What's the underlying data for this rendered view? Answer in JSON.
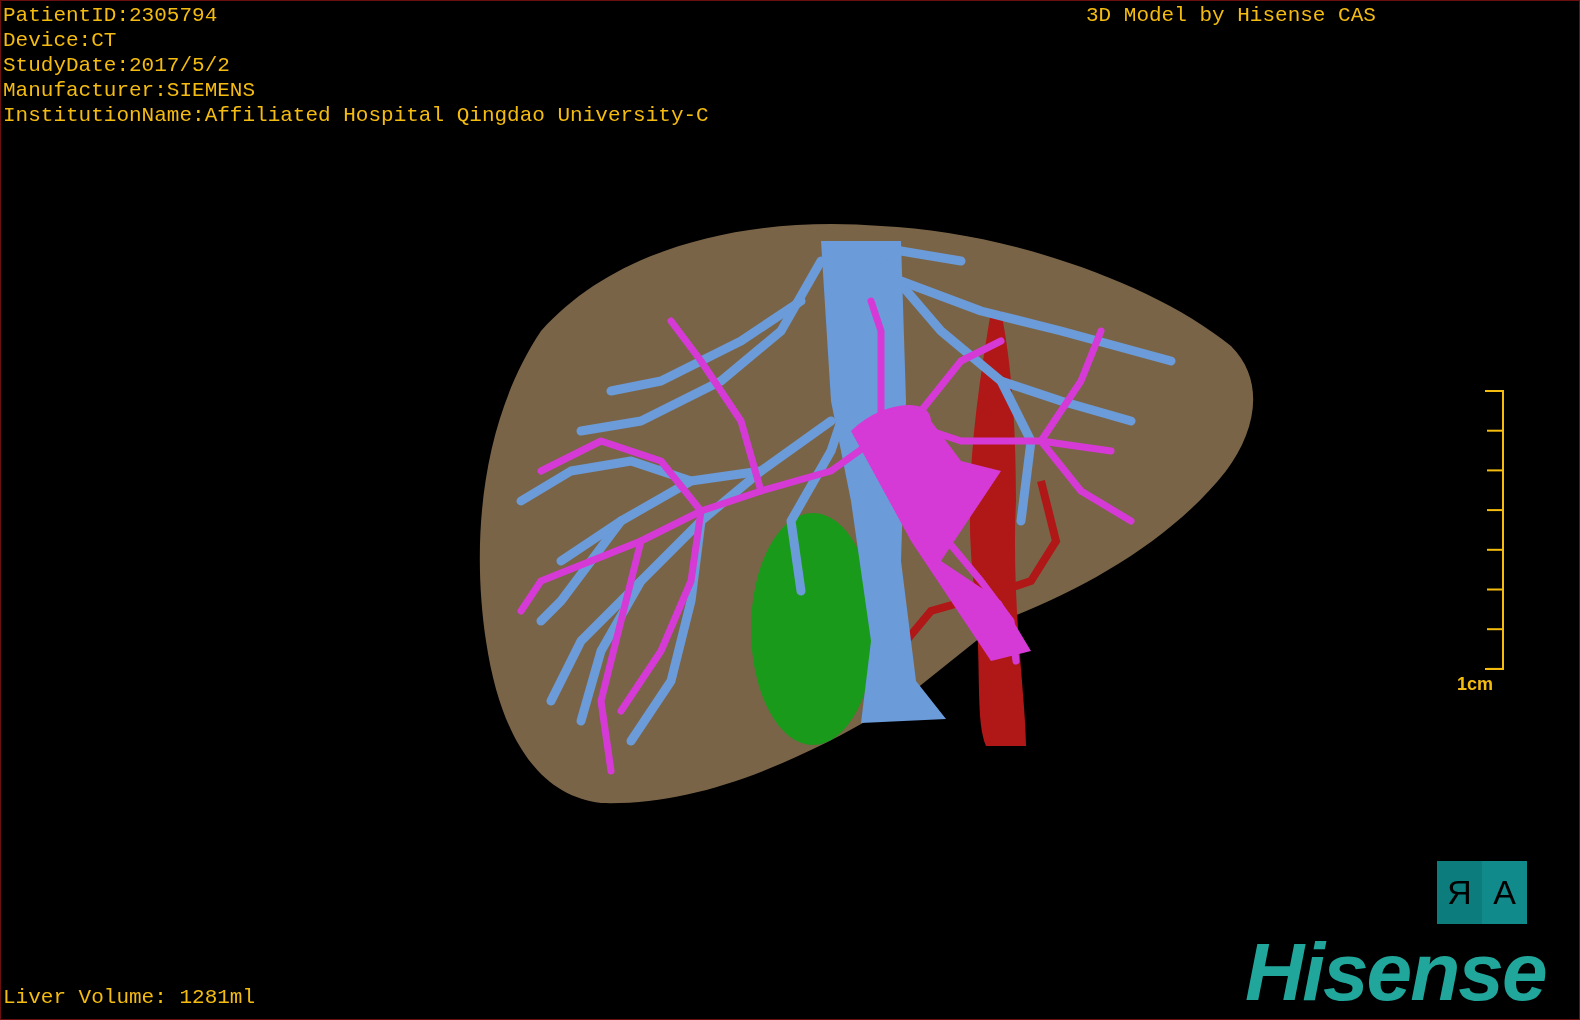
{
  "study_info": [
    "PatientID:2305794",
    "Device:CT",
    "StudyDate:2017/5/2",
    "Manufacturer:SIEMENS",
    "InstitutionName:Affiliated Hospital Qingdao University-C"
  ],
  "model_caption": "3D Model by Hisense CAS",
  "scale_bar": {
    "label": "1cm"
  },
  "orientation_cube": {
    "faces": [
      "R",
      "A"
    ]
  },
  "liver_volume": "Liver Volume: 1281ml",
  "logo": "Hisense"
}
